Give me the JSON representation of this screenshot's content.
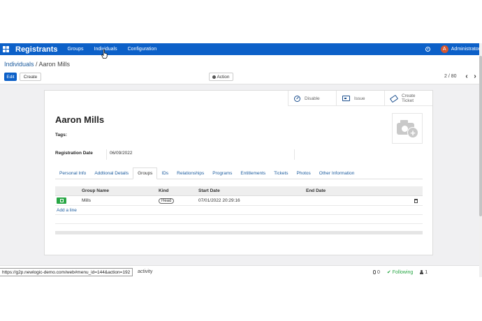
{
  "navbar": {
    "brand": "Registrants",
    "items": [
      {
        "label": "Groups"
      },
      {
        "label": "Individuals"
      },
      {
        "label": "Configuration"
      }
    ],
    "avatar_letter": "A",
    "user": "Administrator",
    "color": "#0c60c8"
  },
  "breadcrumb": {
    "parent": "Individuals",
    "separator": " / ",
    "current": "Aaron Mills"
  },
  "toolbar": {
    "edit_label": "Edit",
    "create_label": "Create",
    "action_label": "Action",
    "pager": "2 / 80",
    "prev": "‹",
    "next": "›"
  },
  "smart_buttons": {
    "disable": "Disable",
    "issue": "Issue",
    "create_ticket_line1": "Create",
    "create_ticket_line2": "Ticket"
  },
  "record": {
    "name": "Aaron Mills",
    "tags_label": "Tags:",
    "registration_date_label": "Registration Date",
    "registration_date": "06/09/2022"
  },
  "tabs": [
    {
      "label": "Personal Info",
      "active": false
    },
    {
      "label": "Addtional Details",
      "active": false
    },
    {
      "label": "Groups",
      "active": true
    },
    {
      "label": "IDs",
      "active": false
    },
    {
      "label": "Relationships",
      "active": false
    },
    {
      "label": "Programs",
      "active": false
    },
    {
      "label": "Entitlements",
      "active": false
    },
    {
      "label": "Tickets",
      "active": false
    },
    {
      "label": "Photos",
      "active": false
    },
    {
      "label": "Other Information",
      "active": false
    }
  ],
  "groups_table": {
    "columns": [
      "Group Name",
      "Kind",
      "Start Date",
      "End Date"
    ],
    "rows": [
      {
        "group_name": "Mills",
        "kind": "Head",
        "start_date": "07/01/2022 20:29:16",
        "end_date": ""
      }
    ],
    "add_line": "Add a line"
  },
  "chatter": {
    "activity": "activity",
    "attachments": "0",
    "following": "Following",
    "followers": "1"
  },
  "statusbar": {
    "url": "https://g2p.newlogic-demo.com/web#menu_id=144&action=192"
  },
  "icons": {
    "apps": "apps-grid-icon",
    "help": "help-icon",
    "action": "gear-icon",
    "disable": "ban-icon",
    "issue": "id-card-icon",
    "ticket": "ticket-icon",
    "photo": "camera-plus-icon",
    "open": "external-link-icon",
    "delete": "trash-icon",
    "attachment": "paperclip-icon",
    "follow": "check-icon",
    "followers": "person-icon",
    "cursor": "hand-pointer-icon"
  },
  "colors": {
    "navbar": "#0c60c8",
    "link": "#1b5b9e",
    "open_button": "#28a745",
    "following": "#28a745",
    "avatar": "#d7572e"
  }
}
